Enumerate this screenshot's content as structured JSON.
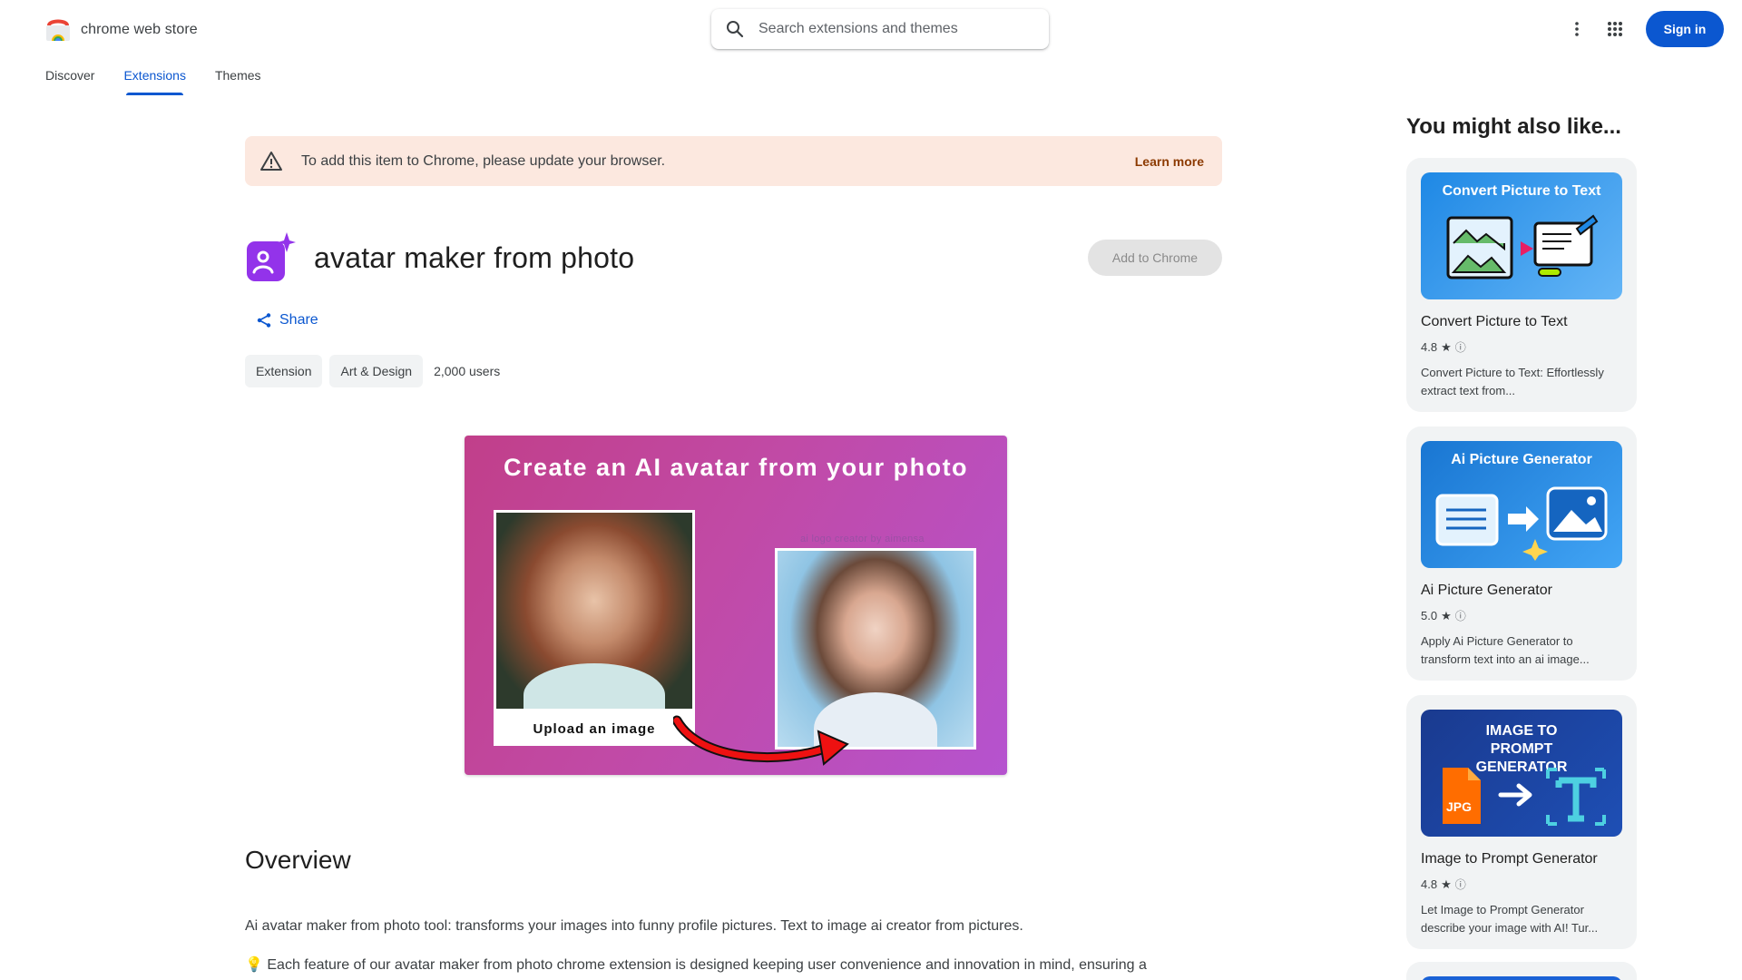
{
  "header": {
    "logo_text": "chrome web store",
    "search_placeholder": "Search extensions and themes",
    "signin_label": "Sign in"
  },
  "nav": {
    "items": [
      {
        "label": "Discover",
        "active": false
      },
      {
        "label": "Extensions",
        "active": true
      },
      {
        "label": "Themes",
        "active": false
      }
    ]
  },
  "banner": {
    "text": "To add this item to Chrome, please update your browser.",
    "link": "Learn more"
  },
  "extension": {
    "title": "avatar maker from photo",
    "add_button": "Add to Chrome",
    "share_label": "Share",
    "chips": [
      "Extension",
      "Art & Design"
    ],
    "users": "2,000 users",
    "accent_color": "#9333ea"
  },
  "hero": {
    "title": "Create an AI avatar from your photo",
    "upload_caption": "Upload an image",
    "watermark": "ai logo creator by aimensa"
  },
  "overview": {
    "heading": "Overview",
    "paragraph1": "Ai avatar maker from photo tool: transforms your images into funny profile pictures. Text to image ai creator from pictures.",
    "paragraph2": "💡 Each feature of our avatar maker from photo chrome extension is designed keeping user convenience and innovation in mind, ensuring a seamless experience while pushing creative boundaries."
  },
  "sidebar": {
    "title": "You might also like...",
    "cards": [
      {
        "image_title": "Convert Picture to Text",
        "name": "Convert Picture to Text",
        "rating": "4.8",
        "description": "Convert Picture to Text: Effortlessly extract text from..."
      },
      {
        "image_title": "Ai Picture Generator",
        "name": "Ai Picture Generator",
        "rating": "5.0",
        "description": "Apply Ai Picture Generator to transform text into an ai image..."
      },
      {
        "image_title": "IMAGE TO PROMPT GENERATOR",
        "image_badge": "JPG",
        "name": "Image to Prompt Generator",
        "rating": "4.8",
        "description": "Let Image to Prompt Generator describe your image with AI! Tur..."
      }
    ]
  },
  "colors": {
    "primary": "#0b57d0",
    "banner_bg": "#fce8df",
    "banner_link": "#8c3a00"
  }
}
